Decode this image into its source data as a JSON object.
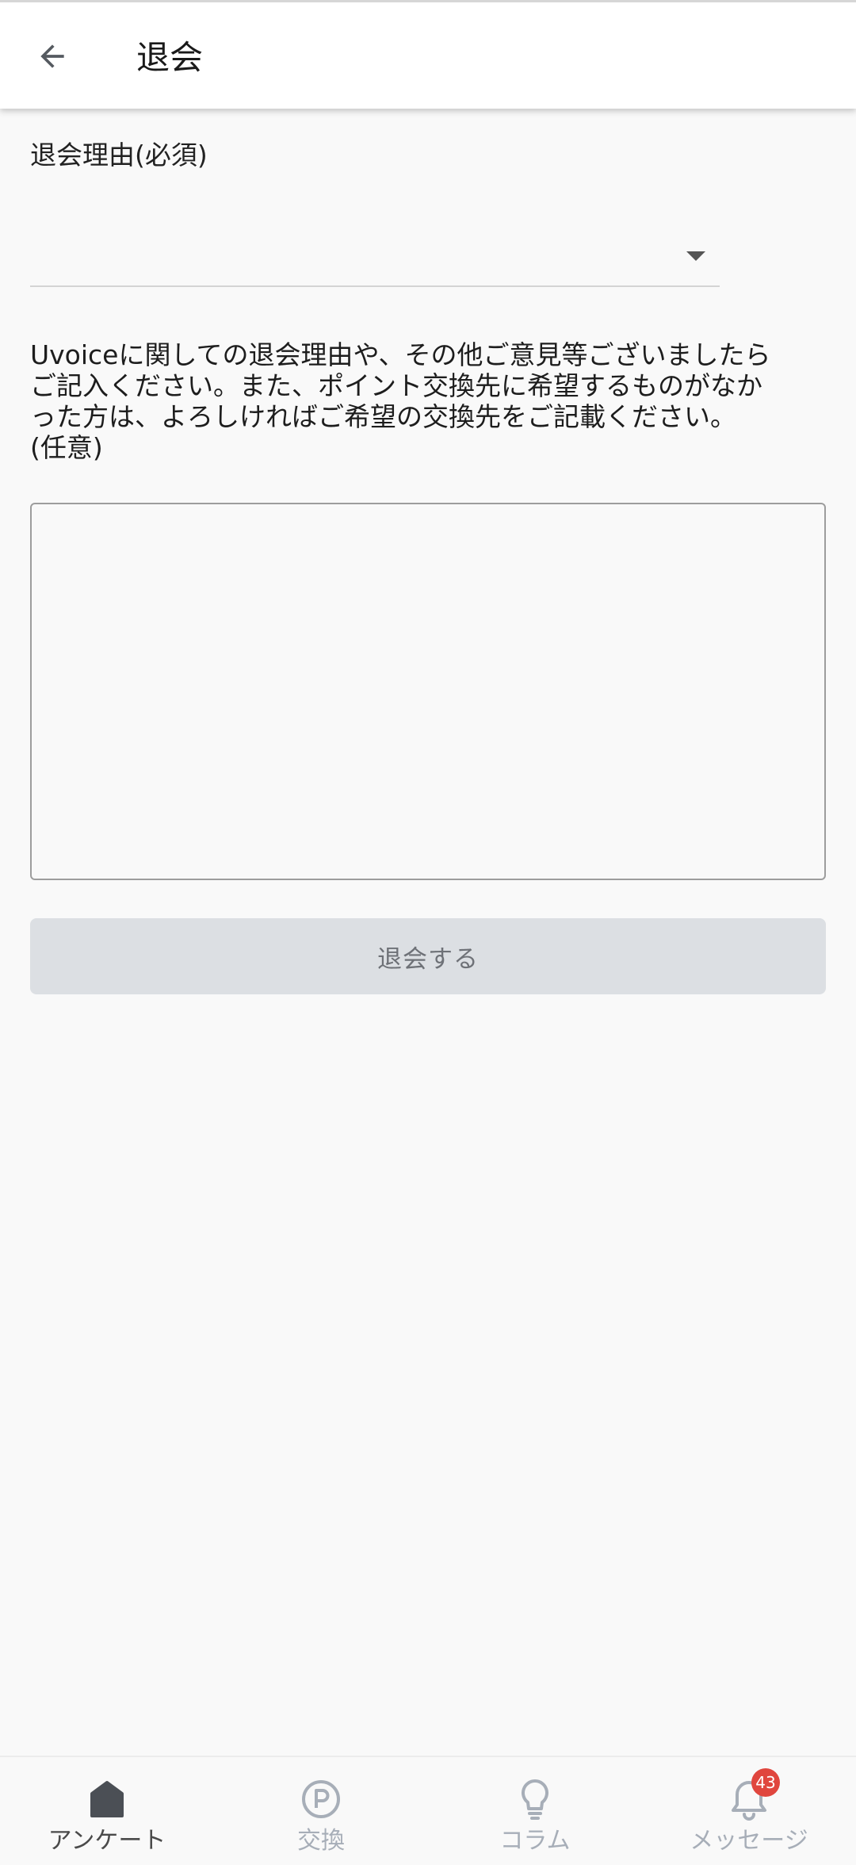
{
  "header": {
    "title": "退会"
  },
  "form": {
    "reason_label": "退会理由(必須)",
    "reason_select_value": "",
    "description": "Uvoiceに関しての退会理由や、その他ご意見等ございましたら\nご記入ください。また、ポイント交換先に希望するものがなか\nった方は、よろしければご希望の交換先をご記載ください。\n(任意)",
    "comment_value": "",
    "submit_label": "退会する"
  },
  "bottom_nav": {
    "items": [
      {
        "label": "アンケート",
        "icon": "home-icon",
        "active": true
      },
      {
        "label": "交換",
        "icon": "points-icon",
        "active": false
      },
      {
        "label": "コラム",
        "icon": "lightbulb-icon",
        "active": false
      },
      {
        "label": "メッセージ",
        "icon": "bell-icon",
        "active": false,
        "badge": "43"
      }
    ]
  },
  "colors": {
    "active_icon": "#4b4f55",
    "inactive_icon": "#a7aeb8",
    "badge": "#e0463e",
    "button_bg": "#dcdfe3"
  }
}
